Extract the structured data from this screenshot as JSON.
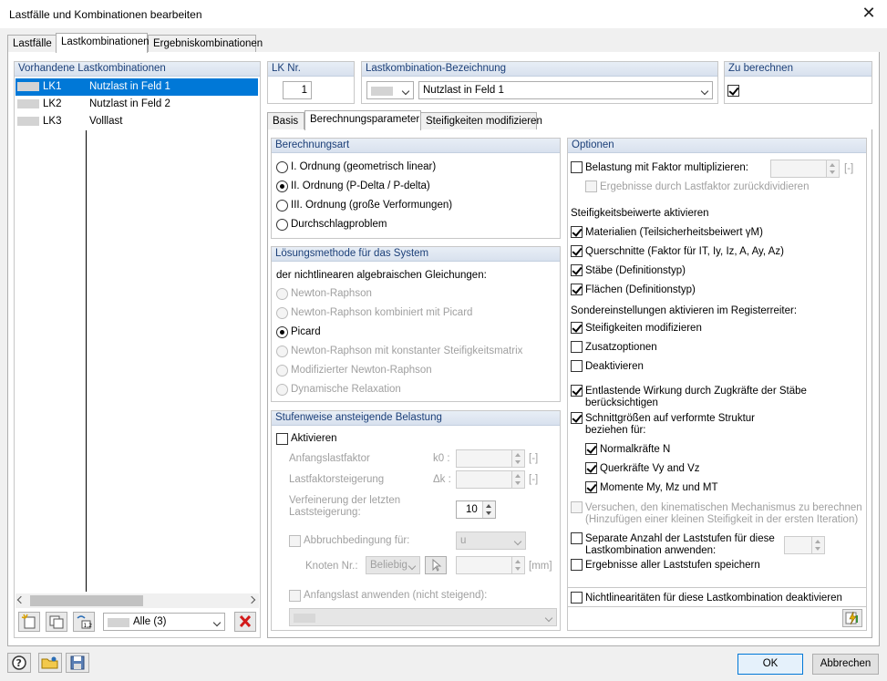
{
  "window": {
    "title": "Lastfälle und Kombinationen bearbeiten",
    "close_glyph": "✕"
  },
  "main_tabs": [
    "Lastfälle",
    "Lastkombinationen",
    "Ergebniskombinationen"
  ],
  "left": {
    "header": "Vorhandene Lastkombinationen",
    "rows": [
      {
        "id": "LK1",
        "name": "Nutzlast in Feld 1"
      },
      {
        "id": "LK2",
        "name": "Nutzlast in Feld 2"
      },
      {
        "id": "LK3",
        "name": "Volllast"
      }
    ],
    "filter_value": "Alle (3)"
  },
  "lk_nr": {
    "label": "LK Nr.",
    "value": "1"
  },
  "bezeichnung": {
    "label": "Lastkombination-Bezeichnung",
    "value": "Nutzlast in Feld 1"
  },
  "zu_berechnen": {
    "label": "Zu berechnen",
    "checked": true
  },
  "sub_tabs": [
    "Basis",
    "Berechnungsparameter",
    "Steifigkeiten modifizieren"
  ],
  "berechnungsart": {
    "header": "Berechnungsart",
    "options": [
      "I. Ordnung (geometrisch linear)",
      "II. Ordnung (P-Delta / P-delta)",
      "III. Ordnung (große Verformungen)",
      "Durchschlagproblem"
    ],
    "selected": 1
  },
  "loesung": {
    "header": "Lösungsmethode für das System",
    "intro": "der nichtlinearen algebraischen Gleichungen:",
    "options": [
      "Newton-Raphson",
      "Newton-Raphson kombiniert mit Picard",
      "Picard",
      "Newton-Raphson mit konstanter Steifigkeitsmatrix",
      "Modifizierter Newton-Raphson",
      "Dynamische Relaxation"
    ],
    "selected": 2
  },
  "stufen": {
    "header": "Stufenweise ansteigende Belastung",
    "aktivieren": "Aktivieren",
    "anfangslastfaktor": "Anfangslastfaktor",
    "k0": "k0 :",
    "lastfaktorsteigerung": "Lastfaktorsteigerung",
    "dk": "Δk :",
    "unit_dash": "[-]",
    "verfeinerung": [
      "Verfeinerung der letzten",
      "Laststeigerung:"
    ],
    "verfeinerung_value": "10",
    "abbruch": "Abbruchbedingung für:",
    "abbruch_value": "u",
    "knoten": "Knoten Nr.:",
    "knoten_value": "Beliebig",
    "unit_mm": "[mm]",
    "anfangslast": "Anfangslast anwenden (nicht steigend):"
  },
  "optionen": {
    "header": "Optionen",
    "belastung": "Belastung mit Faktor multiplizieren:",
    "unit_dash": "[-]",
    "ergebnisse_durch": "Ergebnisse durch Lastfaktor zurückdividieren",
    "steif_header": "Steifigkeitsbeiwerte aktivieren",
    "materialien": "Materialien (Teilsicherheitsbeiwert γM)",
    "querschnitte": "Querschnitte (Faktor für IT, Iy, Iz, A, Ay, Az)",
    "staebe": "Stäbe (Definitionstyp)",
    "flaechen": "Flächen (Definitionstyp)",
    "sonder_header": "Sondereinstellungen aktivieren im Registerreiter:",
    "steif_mod": "Steifigkeiten modifizieren",
    "zusatz": "Zusatzoptionen",
    "deaktivieren": "Deaktivieren",
    "entlastende": [
      "Entlastende Wirkung durch Zugkräfte der Stäbe",
      "berücksichtigen"
    ],
    "schnitt": [
      "Schnittgrößen auf verformte Struktur",
      "beziehen für:"
    ],
    "normal": "Normalkräfte N",
    "quer": "Querkräfte Vy and Vz",
    "momente": "Momente My, Mz und MT",
    "versuchen": [
      "Versuchen, den kinematischen Mechanismus zu berechnen",
      "(Hinzufügen einer kleinen Steifigkeit in der ersten Iteration)"
    ],
    "separate": [
      "Separate Anzahl der Laststufen für diese",
      "Lastkombination anwenden:"
    ],
    "speichern": "Ergebnisse aller Laststufen speichern",
    "nichtlin": "Nichtlinearitäten für diese Lastkombination deaktivieren"
  },
  "footer": {
    "ok": "OK",
    "cancel": "Abbrechen"
  }
}
